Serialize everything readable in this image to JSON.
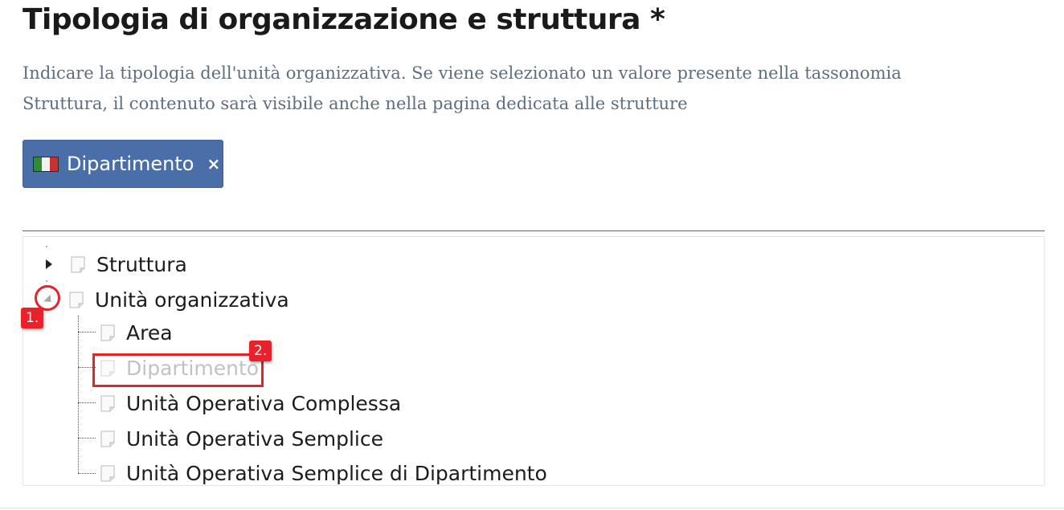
{
  "heading": "Tipologia di organizzazione e struttura *",
  "description_line1": "Indicare la tipologia dell'unità organizzativa. Se viene selezionato un valore presente nella tassonomia",
  "description_line2": "Struttura, il contenuto sarà visibile anche nella pagina dedicata alle strutture",
  "selected_tag": {
    "label": "Dipartimento",
    "remove": "×",
    "flag_icon": "italy-flag-icon"
  },
  "tree": {
    "roots": [
      {
        "label": "Struttura",
        "expanded": false,
        "icon": "document-icon"
      },
      {
        "label": "Unità organizzativa",
        "expanded": true,
        "icon": "document-icon"
      }
    ],
    "children": [
      {
        "label": "Area",
        "disabled": false
      },
      {
        "label": "Dipartimento",
        "disabled": true
      },
      {
        "label": "Unità Operativa Complessa",
        "disabled": false
      },
      {
        "label": "Unità Operativa Semplice",
        "disabled": false
      },
      {
        "label": "Unità Operativa Semplice di Dipartimento",
        "disabled": false
      }
    ]
  },
  "annotations": {
    "step1": "1.",
    "step2": "2.",
    "color": "#e8212a"
  },
  "colors": {
    "tag_background": "#4a6ea8",
    "description_text": "#5b6f82",
    "disabled_text": "#c2c2c2"
  }
}
